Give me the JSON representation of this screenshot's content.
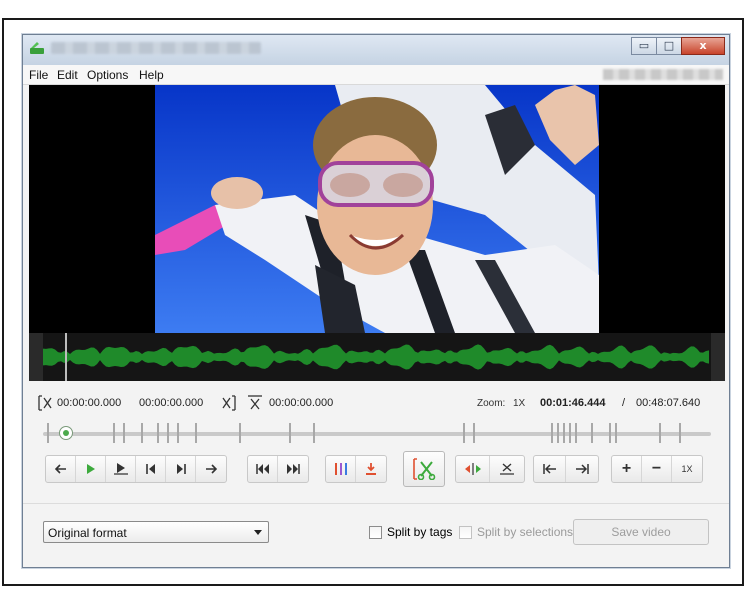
{
  "menu": {
    "file": "File",
    "edit": "Edit",
    "options": "Options",
    "help": "Help"
  },
  "window_buttons": {
    "minimize": "▭",
    "maximize": "□",
    "close": "x"
  },
  "selection": {
    "start_time": "00:00:00.000",
    "end_time": "00:00:00.000",
    "cut_time": "00:00:00.000"
  },
  "zoom": {
    "label": "Zoom:",
    "level": "1X"
  },
  "playback": {
    "current_time": "00:01:46.444",
    "separator": "/",
    "total_time": "00:48:07.640"
  },
  "zoom_controls": {
    "plus": "+",
    "minus": "−",
    "reset": "1X"
  },
  "output": {
    "format_value": "Original format",
    "split_by_tags": "Split by tags",
    "split_by_selections": "Split by selections",
    "save_label": "Save video"
  },
  "colors": {
    "accent_green": "#3daa3d",
    "accent_red": "#e05030",
    "waveform": "#1f8a2a"
  },
  "icons": {
    "prev": "arrow-left-icon",
    "play": "play-icon",
    "play_selection": "play-selection-icon",
    "prev_frame": "prev-frame-icon",
    "next_frame": "next-frame-icon",
    "next": "arrow-right-icon",
    "skip_back": "skip-back-icon",
    "skip_forward": "skip-forward-icon",
    "markers": "markers-icon",
    "add_marker": "add-marker-icon",
    "cut": "scissors-icon",
    "split": "split-icon",
    "delete_marker": "delete-marker-icon",
    "goto_start": "goto-start-icon",
    "goto_end": "goto-end-icon"
  }
}
